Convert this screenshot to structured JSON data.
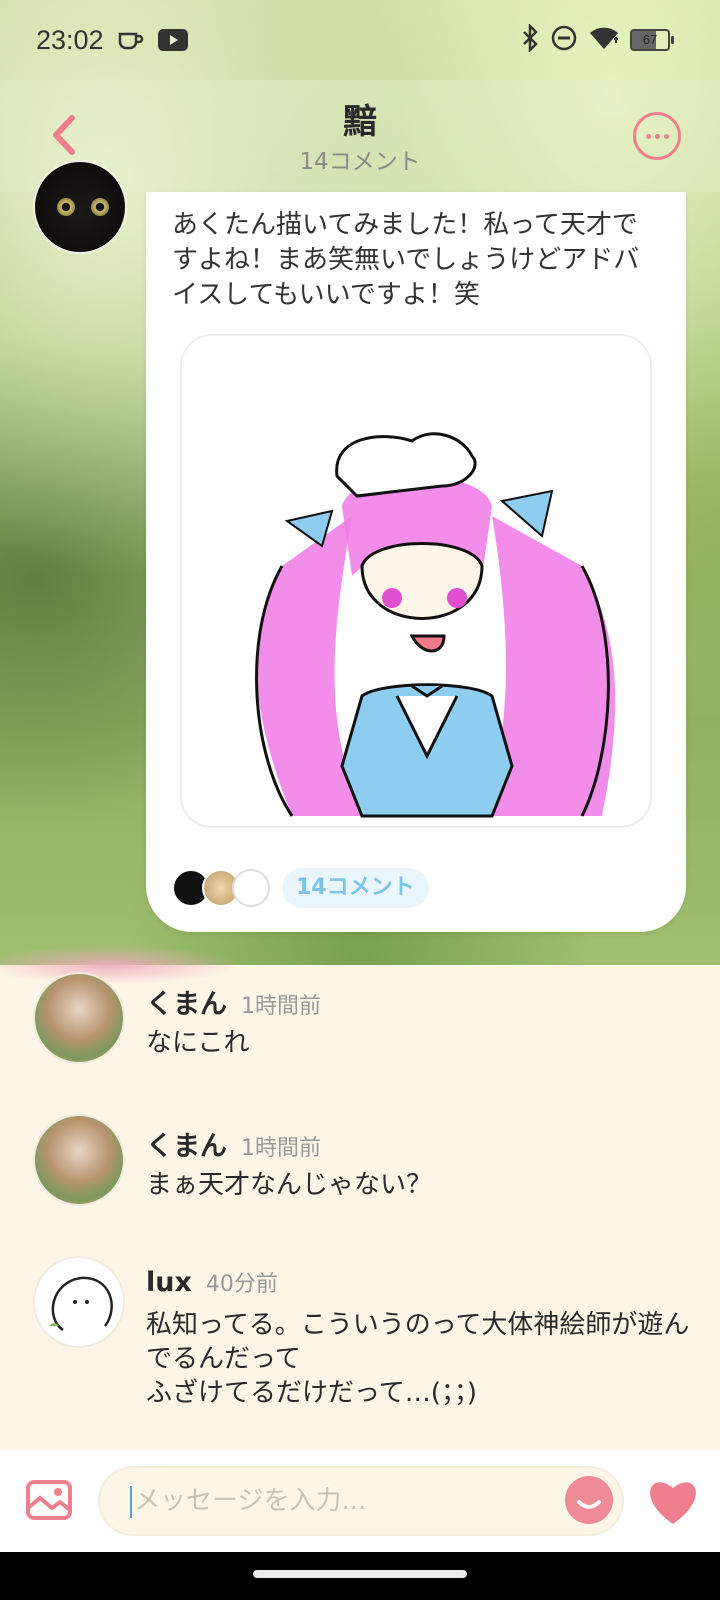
{
  "status_bar": {
    "time": "23:02",
    "battery": "67"
  },
  "header": {
    "title": "黯",
    "subtitle": "14コメント"
  },
  "post": {
    "text": "あくたん描いてみました！私って天才ですよね！まあ笑無いでしょうけどアドバイスしてもいいですよ！笑",
    "comment_count_label": "14コメント"
  },
  "comments": [
    {
      "name": "くまん",
      "time": "1時間前",
      "text": "なにこれ"
    },
    {
      "name": "くまん",
      "time": "1時間前",
      "text": "まぁ天才なんじゃない？"
    },
    {
      "name": "lux",
      "time": "40分前",
      "text": "私知ってる。こういうのって大体神絵師が遊んでるんだって\nふざけてるだけだって…(；；)"
    }
  ],
  "input": {
    "placeholder": "メッセージを入力..."
  },
  "colors": {
    "accent_pink": "#ef7f8e",
    "pill_blue": "#7cc3ea",
    "cream": "#fdf6e6"
  },
  "icons": [
    "coffee-icon",
    "youtube-icon",
    "bluetooth-icon",
    "dnd-icon",
    "wifi-icon",
    "battery-icon",
    "back-icon",
    "more-icon",
    "image-icon",
    "emoji-icon",
    "heart-icon"
  ]
}
